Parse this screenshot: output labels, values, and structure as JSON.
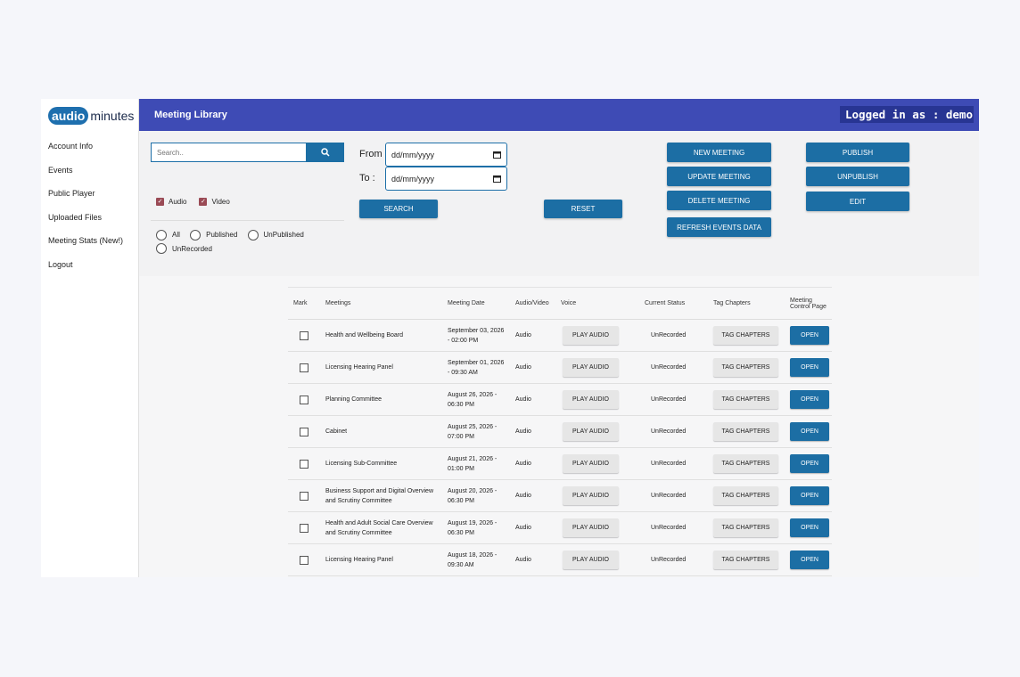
{
  "logo": {
    "part1": "audio",
    "part2": "minutes"
  },
  "sidebar": {
    "items": [
      {
        "label": "Account Info"
      },
      {
        "label": "Events"
      },
      {
        "label": "Public Player"
      },
      {
        "label": "Uploaded Files"
      },
      {
        "label": "Meeting Stats (New!)"
      },
      {
        "label": "Logout"
      }
    ]
  },
  "header": {
    "title": "Meeting Library",
    "logged_in": "Logged in as : demo"
  },
  "filters": {
    "search_placeholder": "Search..",
    "media": [
      {
        "label": "Audio",
        "checked": true
      },
      {
        "label": "Video",
        "checked": true
      }
    ],
    "status_options": [
      {
        "label": "All"
      },
      {
        "label": "Published"
      },
      {
        "label": "UnPublished"
      },
      {
        "label": "UnRecorded"
      }
    ],
    "from_label": "From :",
    "to_label": "To :",
    "date_placeholder": "dd/mm/yyyy",
    "search_button": "SEARCH",
    "reset_button": "RESET"
  },
  "actions": {
    "new_meeting": "NEW MEETING",
    "update_meeting": "UPDATE MEETING",
    "delete_meeting": "DELETE MEETING",
    "refresh_events": "REFRESH EVENTS DATA",
    "publish": "PUBLISH",
    "unpublish": "UNPUBLISH",
    "edit": "EDIT"
  },
  "table": {
    "headers": {
      "mark": "Mark",
      "meetings": "Meetings",
      "date": "Meeting Date",
      "av": "Audio/Video",
      "voice": "Voice",
      "status": "Current Status",
      "chapters": "Tag Chapters",
      "control_1": "Meeting",
      "control_2": "Control Page"
    },
    "play_label": "PLAY AUDIO",
    "tag_label": "TAG CHAPTERS",
    "open_label": "OPEN",
    "rows": [
      {
        "name": [
          "Health and Wellbeing Board",
          ""
        ],
        "date": [
          "September 03, 2026",
          "- 02:00 PM"
        ],
        "av": "Audio",
        "status": "UnRecorded"
      },
      {
        "name": [
          "Licensing Hearing Panel",
          ""
        ],
        "date": [
          "September 01, 2026",
          "- 09:30 AM"
        ],
        "av": "Audio",
        "status": "UnRecorded"
      },
      {
        "name": [
          "Planning Committee",
          ""
        ],
        "date": [
          "August 26, 2026 -",
          "06:30 PM"
        ],
        "av": "Audio",
        "status": "UnRecorded"
      },
      {
        "name": [
          "Cabinet",
          ""
        ],
        "date": [
          "August 25, 2026 -",
          "07:00 PM"
        ],
        "av": "Audio",
        "status": "UnRecorded"
      },
      {
        "name": [
          "Licensing Sub-Committee",
          ""
        ],
        "date": [
          "August 21, 2026 -",
          "01:00 PM"
        ],
        "av": "Audio",
        "status": "UnRecorded"
      },
      {
        "name": [
          "Business Support and Digital Overview",
          "and Scrutiny Committee"
        ],
        "date": [
          "August 20, 2026 -",
          "06:30 PM"
        ],
        "av": "Audio",
        "status": "UnRecorded"
      },
      {
        "name": [
          "Health and Adult Social Care Overview",
          "and Scrutiny Committee"
        ],
        "date": [
          "August 19, 2026 -",
          "06:30 PM"
        ],
        "av": "Audio",
        "status": "UnRecorded"
      },
      {
        "name": [
          "Licensing Hearing Panel",
          ""
        ],
        "date": [
          "August 18, 2026 -",
          "09:30 AM"
        ],
        "av": "Audio",
        "status": "UnRecorded"
      }
    ]
  }
}
